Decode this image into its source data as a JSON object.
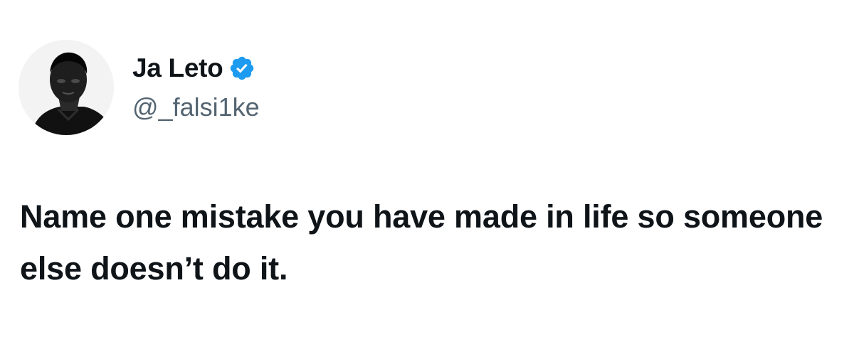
{
  "tweet": {
    "author": {
      "display_name": "Ja Leto",
      "handle": "@_falsi1ke",
      "verified": true,
      "avatar_icon": "person-photo"
    },
    "text": "Name one mistake you have made in life so someone else doesn’t do it."
  },
  "colors": {
    "text_primary": "#0f1419",
    "text_secondary": "#536471",
    "verified_blue": "#1d9bf0",
    "background": "#ffffff"
  }
}
